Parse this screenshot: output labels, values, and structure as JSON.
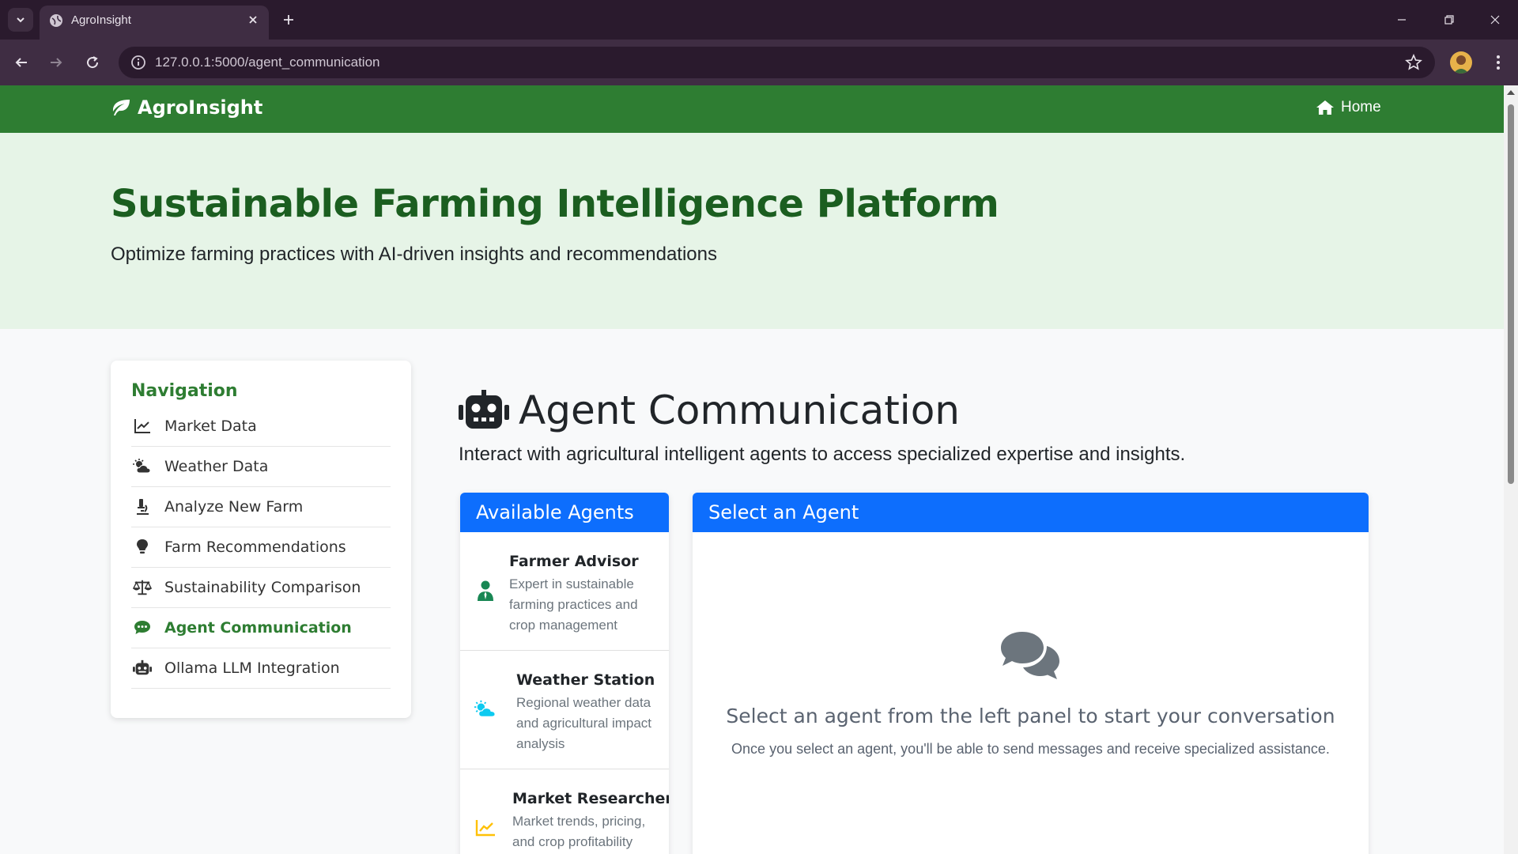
{
  "browser": {
    "tab_title": "AgroInsight",
    "url": "127.0.0.1:5000/agent_communication"
  },
  "navbar": {
    "brand": "AgroInsight",
    "home_label": "Home"
  },
  "hero": {
    "title": "Sustainable Farming Intelligence Platform",
    "subtitle": "Optimize farming practices with AI-driven insights and recommendations"
  },
  "sidebar": {
    "heading": "Navigation",
    "items": [
      {
        "label": "Market Data",
        "icon": "chart-line-icon"
      },
      {
        "label": "Weather Data",
        "icon": "cloud-sun-icon"
      },
      {
        "label": "Analyze New Farm",
        "icon": "microscope-icon"
      },
      {
        "label": "Farm Recommendations",
        "icon": "lightbulb-icon"
      },
      {
        "label": "Sustainability Comparison",
        "icon": "balance-scale-icon"
      },
      {
        "label": "Agent Communication",
        "icon": "comment-dots-icon",
        "active": true
      },
      {
        "label": "Ollama LLM Integration",
        "icon": "robot-icon"
      }
    ]
  },
  "main": {
    "title": "Agent Communication",
    "subtitle": "Interact with agricultural intelligent agents to access specialized expertise and insights."
  },
  "agents": {
    "header": "Available Agents",
    "items": [
      {
        "name": "Farmer Advisor",
        "description": "Expert in sustainable farming practices and crop management",
        "icon": "user-tie-icon",
        "color": "#198754"
      },
      {
        "name": "Weather Station",
        "description": "Regional weather data and agricultural impact analysis",
        "icon": "cloud-sun-icon",
        "color": "#0dcaf0"
      },
      {
        "name": "Market Researcher",
        "description": "Market trends, pricing, and crop profitability",
        "icon": "chart-line-icon",
        "color": "#ffc107"
      }
    ]
  },
  "chat": {
    "header": "Select an Agent",
    "empty_title": "Select an agent from the left panel to start your conversation",
    "empty_subtitle": "Once you select an agent, you'll be able to send messages and receive specialized assistance."
  },
  "colors": {
    "brand_green": "#2e7d32",
    "hero_bg": "#e6f4e7",
    "primary_blue": "#0d6efd",
    "chrome_bg": "#3f2d43"
  }
}
